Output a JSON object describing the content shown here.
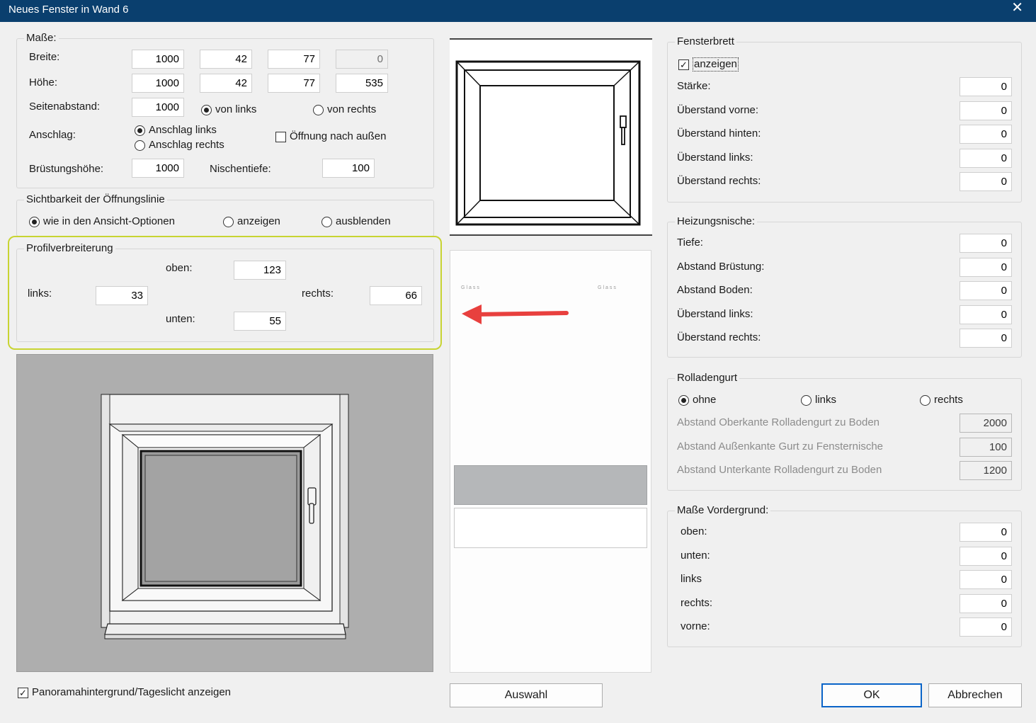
{
  "window": {
    "title": "Neues Fenster in Wand 6",
    "close_glyph": "✕"
  },
  "masse": {
    "legend": "Maße:",
    "breite_label": "Breite:",
    "breite_values": [
      "1000",
      "42",
      "77",
      "0"
    ],
    "hoehe_label": "Höhe:",
    "hoehe_values": [
      "1000",
      "42",
      "77",
      "535"
    ],
    "seitenabstand_label": "Seitenabstand:",
    "seitenabstand_value": "1000",
    "von_links": "von links",
    "von_rechts": "von rechts",
    "anschlag_label": "Anschlag:",
    "anschlag_links": "Anschlag links",
    "anschlag_rechts": "Anschlag rechts",
    "oeffnung_aussen": "Öffnung nach außen",
    "bruestungshoehe_label": "Brüstungshöhe:",
    "bruestungshoehe_value": "1000",
    "nischentiefe_label": "Nischentiefe:",
    "nischentiefe_value": "100"
  },
  "sichtbarkeit": {
    "legend": "Sichtbarkeit der Öffnungslinie",
    "options": [
      "wie in den Ansicht-Optionen",
      "anzeigen",
      "ausblenden"
    ]
  },
  "profil": {
    "legend": "Profilverbreiterung",
    "oben_label": "oben:",
    "oben_value": "123",
    "links_label": "links:",
    "links_value": "33",
    "rechts_label": "rechts:",
    "rechts_value": "66",
    "unten_label": "unten:",
    "unten_value": "55",
    "highlight_color": "#c8d432"
  },
  "library": {
    "glass_left": "Glass",
    "glass_right": "Glass",
    "arrow_color": "#e8403e"
  },
  "fensterbrett": {
    "legend": "Fensterbrett",
    "show_label": "anzeigen",
    "rows": [
      {
        "label": "Stärke:",
        "value": "0"
      },
      {
        "label": "Überstand vorne:",
        "value": "0"
      },
      {
        "label": "Überstand hinten:",
        "value": "0"
      },
      {
        "label": "Überstand links:",
        "value": "0"
      },
      {
        "label": "Überstand rechts:",
        "value": "0"
      }
    ]
  },
  "heizungsnische": {
    "legend": "Heizungsnische:",
    "rows": [
      {
        "label": "Tiefe:",
        "value": "0"
      },
      {
        "label": "Abstand Brüstung:",
        "value": "0"
      },
      {
        "label": "Abstand Boden:",
        "value": "0"
      },
      {
        "label": "Überstand links:",
        "value": "0"
      },
      {
        "label": "Überstand rechts:",
        "value": "0"
      }
    ]
  },
  "rolladengurt": {
    "legend": "Rolladengurt",
    "options": [
      "ohne",
      "links",
      "rechts"
    ],
    "rows": [
      {
        "label": "Abstand Oberkante Rolladengurt zu Boden",
        "value": "2000"
      },
      {
        "label": "Abstand Außenkante Gurt zu Fensternische",
        "value": "100"
      },
      {
        "label": "Abstand Unterkante Rolladengurt zu Boden",
        "value": "1200"
      }
    ]
  },
  "vordergrund": {
    "legend": "Maße Vordergrund:",
    "rows": [
      {
        "label": "oben:",
        "value": "0"
      },
      {
        "label": "unten:",
        "value": "0"
      },
      {
        "label": "links",
        "value": "0"
      },
      {
        "label": "rechts:",
        "value": "0"
      },
      {
        "label": "vorne:",
        "value": "0"
      }
    ]
  },
  "footer": {
    "panorama_label": "Panoramahintergrund/Tageslicht anzeigen",
    "auswahl": "Auswahl",
    "ok": "OK",
    "abbrechen": "Abbrechen"
  }
}
